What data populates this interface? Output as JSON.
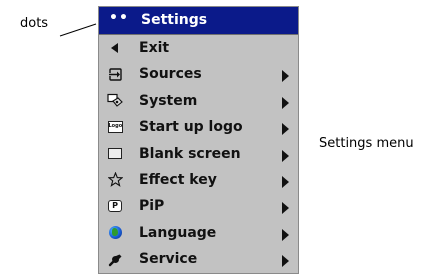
{
  "callouts": {
    "dots": "dots",
    "menu": "Settings menu"
  },
  "menu": {
    "header": {
      "dots": "••",
      "title": "Settings"
    },
    "items": [
      {
        "label": "Exit",
        "icon": "back-arrow-icon",
        "submenu": false
      },
      {
        "label": "Sources",
        "icon": "sources-icon",
        "submenu": true
      },
      {
        "label": "System",
        "icon": "system-icon",
        "submenu": true
      },
      {
        "label": "Start up logo",
        "icon": "logo-icon",
        "submenu": true
      },
      {
        "label": "Blank screen",
        "icon": "blank-screen-icon",
        "submenu": true
      },
      {
        "label": "Effect key",
        "icon": "star-icon",
        "submenu": true
      },
      {
        "label": "PiP",
        "icon": "pip-icon",
        "submenu": true
      },
      {
        "label": "Language",
        "icon": "globe-icon",
        "submenu": true
      },
      {
        "label": "Service",
        "icon": "wrench-icon",
        "submenu": true
      }
    ],
    "icon_text": {
      "logo": "Logo",
      "pip": "P"
    }
  },
  "colors": {
    "header_bg": "#0b1a8a",
    "menu_bg": "#c2c2c2"
  }
}
